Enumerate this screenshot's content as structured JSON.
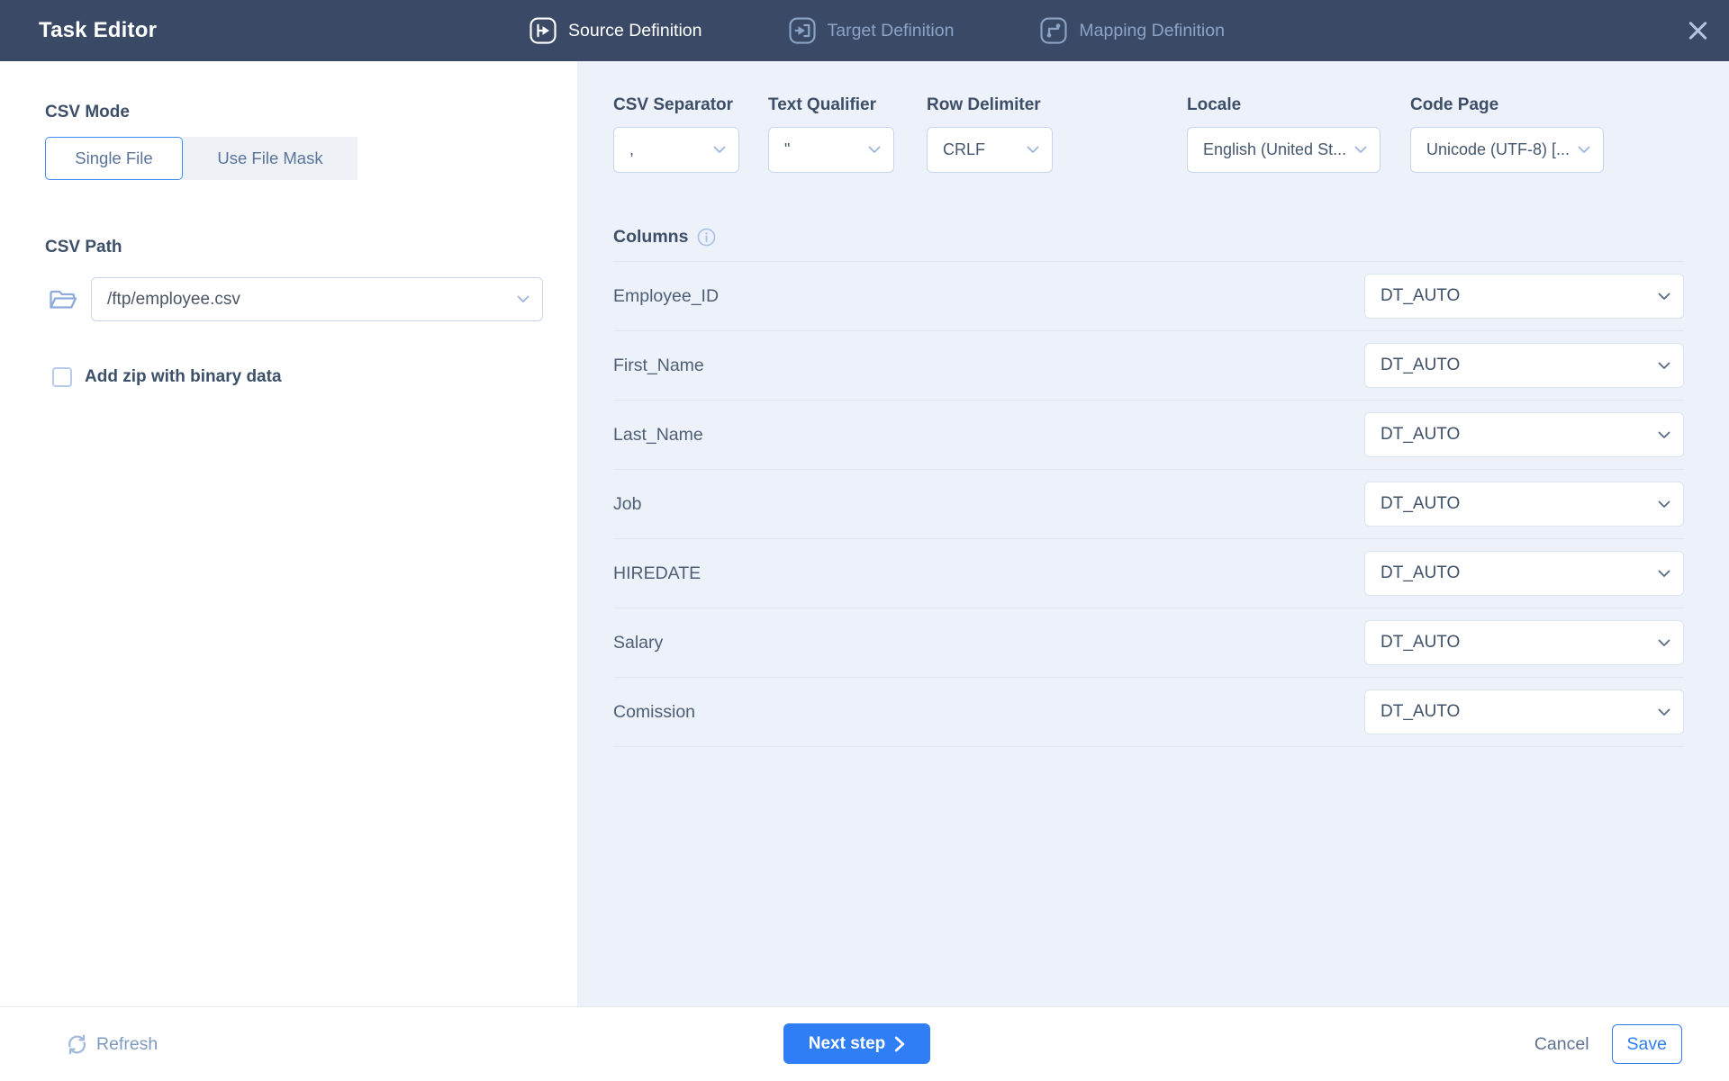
{
  "header": {
    "title": "Task Editor",
    "tabs": [
      {
        "label": "Source Definition",
        "icon": "source",
        "active": true
      },
      {
        "label": "Target Definition",
        "icon": "target",
        "active": false
      },
      {
        "label": "Mapping Definition",
        "icon": "mapping",
        "active": false
      }
    ]
  },
  "left_panel": {
    "csv_mode": {
      "label": "CSV Mode",
      "options": [
        {
          "label": "Single File",
          "selected": true
        },
        {
          "label": "Use File Mask",
          "selected": false
        }
      ]
    },
    "csv_path": {
      "label": "CSV Path",
      "value": "/ftp/employee.csv"
    },
    "zip_checkbox": {
      "label": "Add zip with binary data",
      "checked": false
    }
  },
  "settings": {
    "fields": [
      {
        "label": "CSV Separator",
        "value": ","
      },
      {
        "label": "Text Qualifier",
        "value": "\""
      },
      {
        "label": "Row Delimiter",
        "value": "CRLF"
      },
      {
        "label": "Locale",
        "value": "English (United St..."
      },
      {
        "label": "Code Page",
        "value": "Unicode (UTF-8) [..."
      }
    ]
  },
  "columns": {
    "title": "Columns",
    "rows": [
      {
        "name": "Employee_ID",
        "type": "DT_AUTO"
      },
      {
        "name": "First_Name",
        "type": "DT_AUTO"
      },
      {
        "name": "Last_Name",
        "type": "DT_AUTO"
      },
      {
        "name": "Job",
        "type": "DT_AUTO"
      },
      {
        "name": "HIREDATE",
        "type": "DT_AUTO"
      },
      {
        "name": "Salary",
        "type": "DT_AUTO"
      },
      {
        "name": "Comission",
        "type": "DT_AUTO"
      }
    ]
  },
  "footer": {
    "refresh_label": "Refresh",
    "next_label": "Next step",
    "cancel_label": "Cancel",
    "save_label": "Save"
  },
  "icons": {
    "close": "x-cross",
    "source": "branch-arrow-in-rounded-square",
    "target": "arrow-into-bracket-in-rounded-square",
    "mapping": "step-connector-in-rounded-square",
    "folder": "folder-open",
    "info": "info-circle",
    "refresh": "circular-arrows",
    "next": "chevron-right",
    "dropdown": "chevron-down"
  },
  "colors": {
    "header_bg": "#3a4a66",
    "panel_bg": "#edf1f9",
    "accent_blue": "#2f7ef5",
    "label_navy": "#3d4f68",
    "inactive_tab": "#8ba3c6"
  }
}
